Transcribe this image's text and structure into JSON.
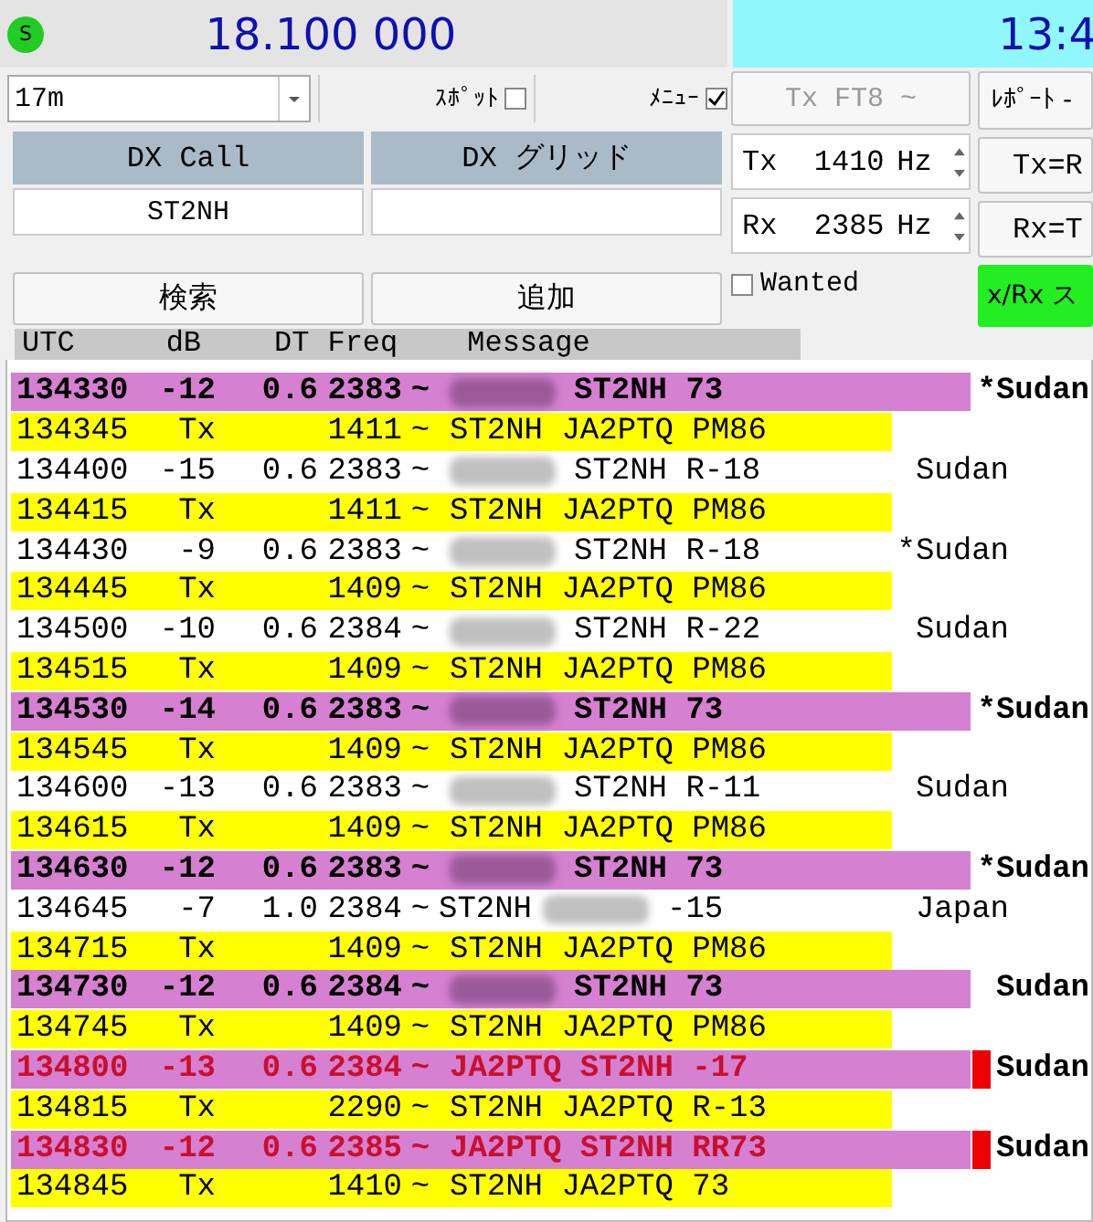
{
  "top_bar": {
    "status_icon_label": "S",
    "frequency": "18.100 000",
    "clock": "13:4"
  },
  "controls": {
    "band": "17m",
    "spot": {
      "label": "ｽﾎﾟｯﾄ",
      "checked": false
    },
    "menu": {
      "label": "ﾒﾆｭｰ",
      "checked": true
    },
    "dx_call": {
      "label": "DX Call",
      "value": "ST2NH"
    },
    "dx_grid": {
      "label": "DX グリッド"
    },
    "search_button": "検索",
    "add_button": "追加",
    "mode_button": {
      "label": "Tx FT8 ~",
      "disabled": true
    },
    "tx_freq": {
      "label": "Tx",
      "value": "1410",
      "unit": "Hz"
    },
    "rx_freq": {
      "label": "Rx",
      "value": "2385",
      "unit": "Hz"
    },
    "wanted": {
      "label": "Wanted",
      "checked": false
    },
    "report_button": "ﾚﾎﾟｰﾄ -",
    "tx_to_rx_button": "Tx=R",
    "rx_to_tx_button": "Rx=T",
    "txrx_button": "x/Rx ス"
  },
  "columns": [
    "UTC",
    "dB",
    "DT",
    "Freq",
    "Message"
  ],
  "rows": [
    {
      "kind": "highlight",
      "utc": "134330",
      "db": "-12",
      "dt": "0.6",
      "freq": "2383",
      "tilde": "~",
      "redacted": true,
      "message": "ST2NH 73",
      "country": "*Sudan"
    },
    {
      "kind": "tx",
      "utc": "134345",
      "db": "Tx",
      "freq": "1411",
      "tilde": "~",
      "redacted": false,
      "message": "ST2NH JA2PTQ PM86"
    },
    {
      "kind": "rx",
      "utc": "134400",
      "db": "-15",
      "dt": "0.6",
      "freq": "2383",
      "tilde": "~",
      "redacted": true,
      "message": "ST2NH R-18",
      "country": "Sudan"
    },
    {
      "kind": "tx",
      "utc": "134415",
      "db": "Tx",
      "freq": "1411",
      "tilde": "~",
      "redacted": false,
      "message": "ST2NH JA2PTQ PM86"
    },
    {
      "kind": "rx",
      "utc": "134430",
      "db": "-9",
      "dt": "0.6",
      "freq": "2383",
      "tilde": "~",
      "redacted": true,
      "message": "ST2NH R-18",
      "country": "*Sudan"
    },
    {
      "kind": "tx",
      "utc": "134445",
      "db": "Tx",
      "freq": "1409",
      "tilde": "~",
      "redacted": false,
      "message": "ST2NH JA2PTQ PM86"
    },
    {
      "kind": "rx",
      "utc": "134500",
      "db": "-10",
      "dt": "0.6",
      "freq": "2384",
      "tilde": "~",
      "redacted": true,
      "message": "ST2NH R-22",
      "country": "Sudan"
    },
    {
      "kind": "tx",
      "utc": "134515",
      "db": "Tx",
      "freq": "1409",
      "tilde": "~",
      "redacted": false,
      "message": "ST2NH JA2PTQ PM86"
    },
    {
      "kind": "highlight",
      "utc": "134530",
      "db": "-14",
      "dt": "0.6",
      "freq": "2383",
      "tilde": "~",
      "redacted": true,
      "message": "ST2NH 73",
      "country": "*Sudan"
    },
    {
      "kind": "tx",
      "utc": "134545",
      "db": "Tx",
      "freq": "1409",
      "tilde": "~",
      "redacted": false,
      "message": "ST2NH JA2PTQ PM86"
    },
    {
      "kind": "rx",
      "utc": "134600",
      "db": "-13",
      "dt": "0.6",
      "freq": "2383",
      "tilde": "~",
      "redacted": true,
      "message": "ST2NH R-11",
      "country": "Sudan"
    },
    {
      "kind": "tx",
      "utc": "134615",
      "db": "Tx",
      "freq": "1409",
      "tilde": "~",
      "redacted": false,
      "message": "ST2NH JA2PTQ PM86"
    },
    {
      "kind": "highlight",
      "utc": "134630",
      "db": "-12",
      "dt": "0.6",
      "freq": "2383",
      "tilde": "~",
      "redacted": true,
      "message": "ST2NH 73",
      "country": "*Sudan"
    },
    {
      "kind": "rx",
      "utc": "134645",
      "db": "-7",
      "dt": "1.0",
      "freq": "2384",
      "tilde": "~",
      "message_before": "ST2NH",
      "redacted": true,
      "message": "-15",
      "country": "Japan"
    },
    {
      "kind": "tx",
      "utc": "134715",
      "db": "Tx",
      "freq": "1409",
      "tilde": "~",
      "redacted": false,
      "message": "ST2NH JA2PTQ PM86"
    },
    {
      "kind": "highlight",
      "utc": "134730",
      "db": "-12",
      "dt": "0.6",
      "freq": "2384",
      "tilde": "~",
      "redacted": true,
      "message": "ST2NH 73",
      "country": "Sudan"
    },
    {
      "kind": "tx",
      "utc": "134745",
      "db": "Tx",
      "freq": "1409",
      "tilde": "~",
      "redacted": false,
      "message": "ST2NH JA2PTQ PM86"
    },
    {
      "kind": "to_me",
      "utc": "134800",
      "db": "-13",
      "dt": "0.6",
      "freq": "2384",
      "tilde": "~",
      "redacted": false,
      "message": "JA2PTQ ST2NH -17",
      "country": "Sudan"
    },
    {
      "kind": "tx",
      "utc": "134815",
      "db": "Tx",
      "freq": "2290",
      "tilde": "~",
      "redacted": false,
      "message": "ST2NH JA2PTQ R-13"
    },
    {
      "kind": "to_me",
      "utc": "134830",
      "db": "-12",
      "dt": "0.6",
      "freq": "2385",
      "tilde": "~",
      "redacted": false,
      "message": "JA2PTQ ST2NH RR73",
      "country": "Sudan"
    },
    {
      "kind": "tx",
      "utc": "134845",
      "db": "Tx",
      "freq": "1410",
      "tilde": "~",
      "redacted": false,
      "message": "ST2NH JA2PTQ 73"
    }
  ]
}
